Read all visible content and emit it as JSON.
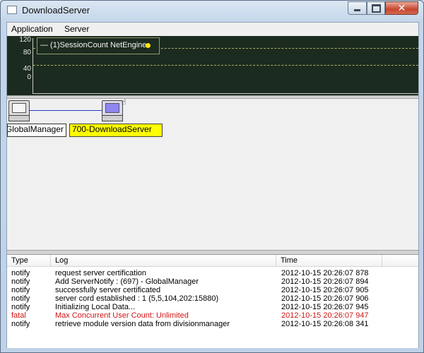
{
  "window": {
    "title": "DownloadServer",
    "controls": {
      "minimize": "—",
      "maximize": "□",
      "close": "✕"
    }
  },
  "menu": {
    "items": [
      "Application",
      "Server"
    ]
  },
  "chart": {
    "y_ticks": [
      "120",
      "80",
      "40",
      "0"
    ],
    "legend": "— (1)SessionCount  NetEngine",
    "legend_color": "#ffe600"
  },
  "diagram": {
    "nodes": [
      {
        "label": "GlobalManager",
        "state": "normal"
      },
      {
        "label": "700-DownloadServer",
        "state": "selected",
        "highlight": "#ffff00"
      }
    ]
  },
  "log": {
    "columns": {
      "type": "Type",
      "log": "Log",
      "time": "Time"
    },
    "rows": [
      {
        "type": "notify",
        "log": "request server certification",
        "time": "2012-10-15 20:26:07 878"
      },
      {
        "type": "notify",
        "log": "Add ServerNotify : (697) - GlobalManager",
        "time": "2012-10-15 20:26:07 894"
      },
      {
        "type": "notify",
        "log": "successfully server certificated",
        "time": "2012-10-15 20:26:07 905"
      },
      {
        "type": "notify",
        "log": "server cord established : 1 (5,5,104,202:15880)",
        "time": "2012-10-15 20:26:07 906"
      },
      {
        "type": "notify",
        "log": "Initializing Local Data...",
        "time": "2012-10-15 20:26:07 945"
      },
      {
        "type": "fatal",
        "log": "Max Concurrent User Count: Unlimited",
        "time": "2012-10-15 20:26:07 947"
      },
      {
        "type": "notify",
        "log": "retrieve module version data from divisionmanager",
        "time": "2012-10-15 20:26:08 341"
      }
    ],
    "fatal_color": "#d21414"
  }
}
